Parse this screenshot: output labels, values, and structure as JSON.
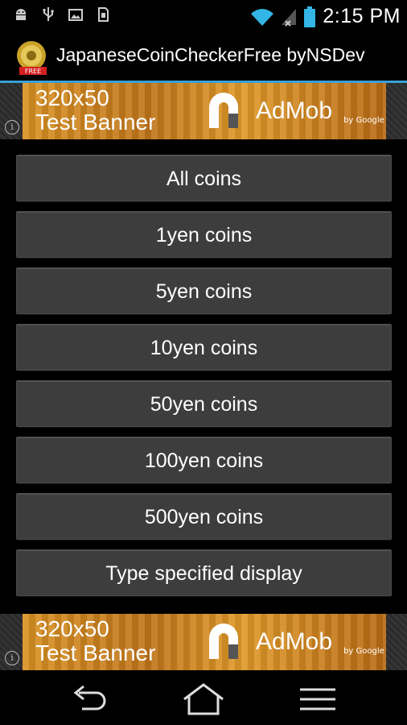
{
  "status_bar": {
    "time": "2:15 PM",
    "icons": [
      "android-debug-icon",
      "usb-icon",
      "photo-icon",
      "sim-icon",
      "wifi-icon",
      "signal-icon",
      "battery-icon"
    ]
  },
  "app": {
    "title": "JapaneseCoinCheckerFree byNSDev",
    "icon": "coin-app-icon",
    "icon_badge": "FREE"
  },
  "ads": {
    "top": {
      "line1": "320x50",
      "line2": "Test Banner",
      "brand": "AdMob",
      "by": "by Google"
    },
    "bottom": {
      "line1": "320x50",
      "line2": "Test Banner",
      "brand": "AdMob",
      "by": "by Google"
    }
  },
  "menu": {
    "items": [
      {
        "label": "All coins"
      },
      {
        "label": "1yen coins"
      },
      {
        "label": "5yen coins"
      },
      {
        "label": "10yen coins"
      },
      {
        "label": "50yen coins"
      },
      {
        "label": "100yen coins"
      },
      {
        "label": "500yen coins"
      },
      {
        "label": "Type specified display"
      }
    ]
  },
  "navbar": {
    "buttons": [
      "back-icon",
      "home-icon",
      "menu-icon"
    ]
  },
  "colors": {
    "accent": "#3aa0d6",
    "button_bg": "#3d3d3d",
    "background": "#000000"
  }
}
